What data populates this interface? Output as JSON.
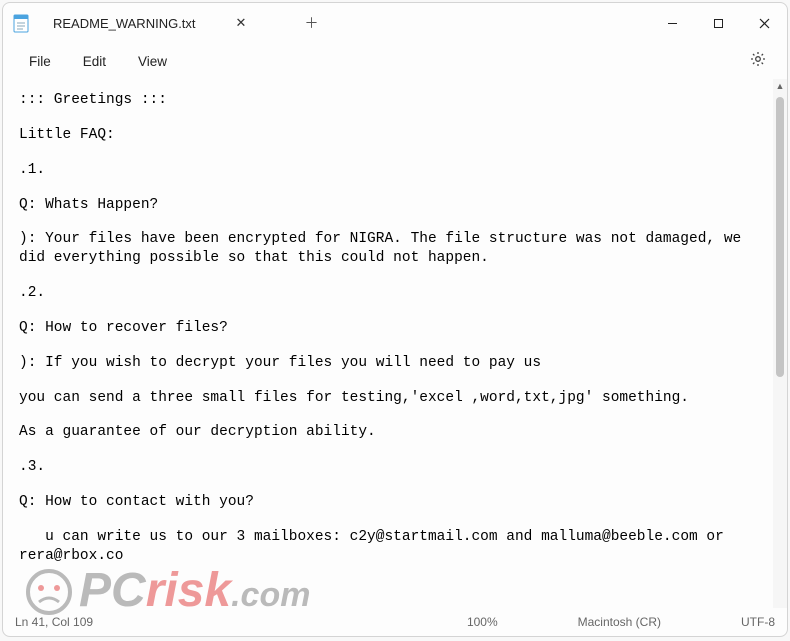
{
  "window": {
    "tab_title": "README_WARNING.txt"
  },
  "menu": {
    "file": "File",
    "edit": "Edit",
    "view": "View"
  },
  "doc": {
    "l1": "::: Greetings :::",
    "l2": "Little FAQ:",
    "l3": ".1.",
    "l4": "Q: Whats Happen?",
    "l5": "): Your files have been encrypted for NIGRA. The file structure was not damaged, we did everything possible so that this could not happen.",
    "l6": ".2.",
    "l7": "Q: How to recover files?",
    "l8": "): If you wish to decrypt your files you will need to pay us",
    "l9": "you can send a three small files for testing,'excel ,word,txt,jpg' something.",
    "l10": "As a guarantee of our decryption ability.",
    "l11": ".3.",
    "l12": "Q: How to contact with you?",
    "l13": "   u can write us to our 3 mailboxes: c2y@startmail.com and malluma@beeble.com or    rera@rbox.co"
  },
  "status": {
    "position": "Ln 41, Col 109",
    "zoom": "100%",
    "line_ending": "Macintosh (CR)",
    "encoding": "UTF-8"
  },
  "watermark": {
    "pc": "PC",
    "risk": "risk",
    "com": ".com"
  }
}
